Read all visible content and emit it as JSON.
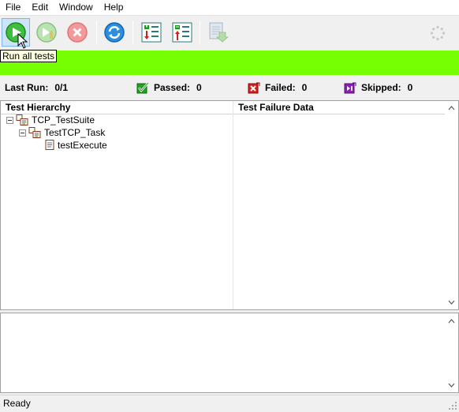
{
  "menu": {
    "items": [
      {
        "label": "File"
      },
      {
        "label": "Edit"
      },
      {
        "label": "Window"
      },
      {
        "label": "Help"
      }
    ]
  },
  "tooltip": {
    "text": "Run all tests"
  },
  "toolbar": {
    "buttons": [
      {
        "name": "run-all-tests-button",
        "icon": "play-icon",
        "state": "active"
      },
      {
        "name": "run-selected-button",
        "icon": "play-step-icon",
        "state": "disabled"
      },
      {
        "name": "stop-button",
        "icon": "stop-icon",
        "state": "disabled"
      },
      {
        "name": "rerun-button",
        "icon": "refresh-icon",
        "state": "enabled"
      },
      {
        "name": "expand-tree-button",
        "icon": "expand-tree-icon",
        "state": "enabled"
      },
      {
        "name": "collapse-tree-button",
        "icon": "collapse-tree-icon",
        "state": "enabled"
      },
      {
        "name": "report-button",
        "icon": "report-icon",
        "state": "disabled"
      }
    ]
  },
  "progress": {
    "fraction": 1.0,
    "color": "#76ff03"
  },
  "stats": {
    "last_run_label": "Last Run:",
    "last_run_value": "0/1",
    "passed_label": "Passed:",
    "passed_value": "0",
    "failed_label": "Failed:",
    "failed_value": "0",
    "skipped_label": "Skipped:",
    "skipped_value": "0",
    "colors": {
      "passed": "#1fa01f",
      "failed": "#d81e1e",
      "skipped": "#8a1fb5"
    }
  },
  "hierarchy": {
    "header": "Test Hierarchy",
    "nodes": [
      {
        "label": "TCP_TestSuite",
        "expanded": true,
        "type": "suite"
      },
      {
        "label": "TestTCP_Task",
        "expanded": true,
        "type": "suite"
      },
      {
        "label": "testExecute",
        "type": "test"
      }
    ]
  },
  "failure": {
    "header": "Test Failure Data"
  },
  "status": {
    "text": "Ready"
  }
}
